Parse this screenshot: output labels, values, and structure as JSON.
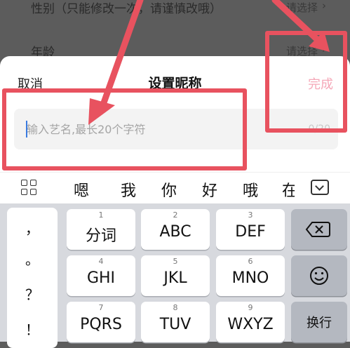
{
  "background_list": {
    "gender_label": "性别（只能修改一次，请谨慎改哦）",
    "gender_value": "请选择",
    "age_label": "年龄",
    "age_value": "请选择"
  },
  "sheet": {
    "cancel_label": "取消",
    "title": "设置昵称",
    "done_label": "完成",
    "input_placeholder": "输入艺名,最长20个字符",
    "counter": "0/20"
  },
  "candidates": {
    "items": [
      "嗯",
      "我",
      "你",
      "好",
      "哦",
      "在"
    ]
  },
  "keyboard": {
    "punctuation": [
      "，",
      "。",
      "？",
      "！"
    ],
    "keys": [
      {
        "num": "1",
        "label": "分词"
      },
      {
        "num": "2",
        "label": "ABC"
      },
      {
        "num": "3",
        "label": "DEF"
      },
      {
        "num": "4",
        "label": "GHI"
      },
      {
        "num": "5",
        "label": "JKL"
      },
      {
        "num": "6",
        "label": "MNO"
      },
      {
        "num": "7",
        "label": "PQRS"
      },
      {
        "num": "8",
        "label": "TUV"
      },
      {
        "num": "9",
        "label": "WXYZ"
      }
    ],
    "backspace_icon": "backspace-icon",
    "emoji_icon": "emoji-icon",
    "newline_label": "换行"
  },
  "annotation_color": "#e8525f"
}
